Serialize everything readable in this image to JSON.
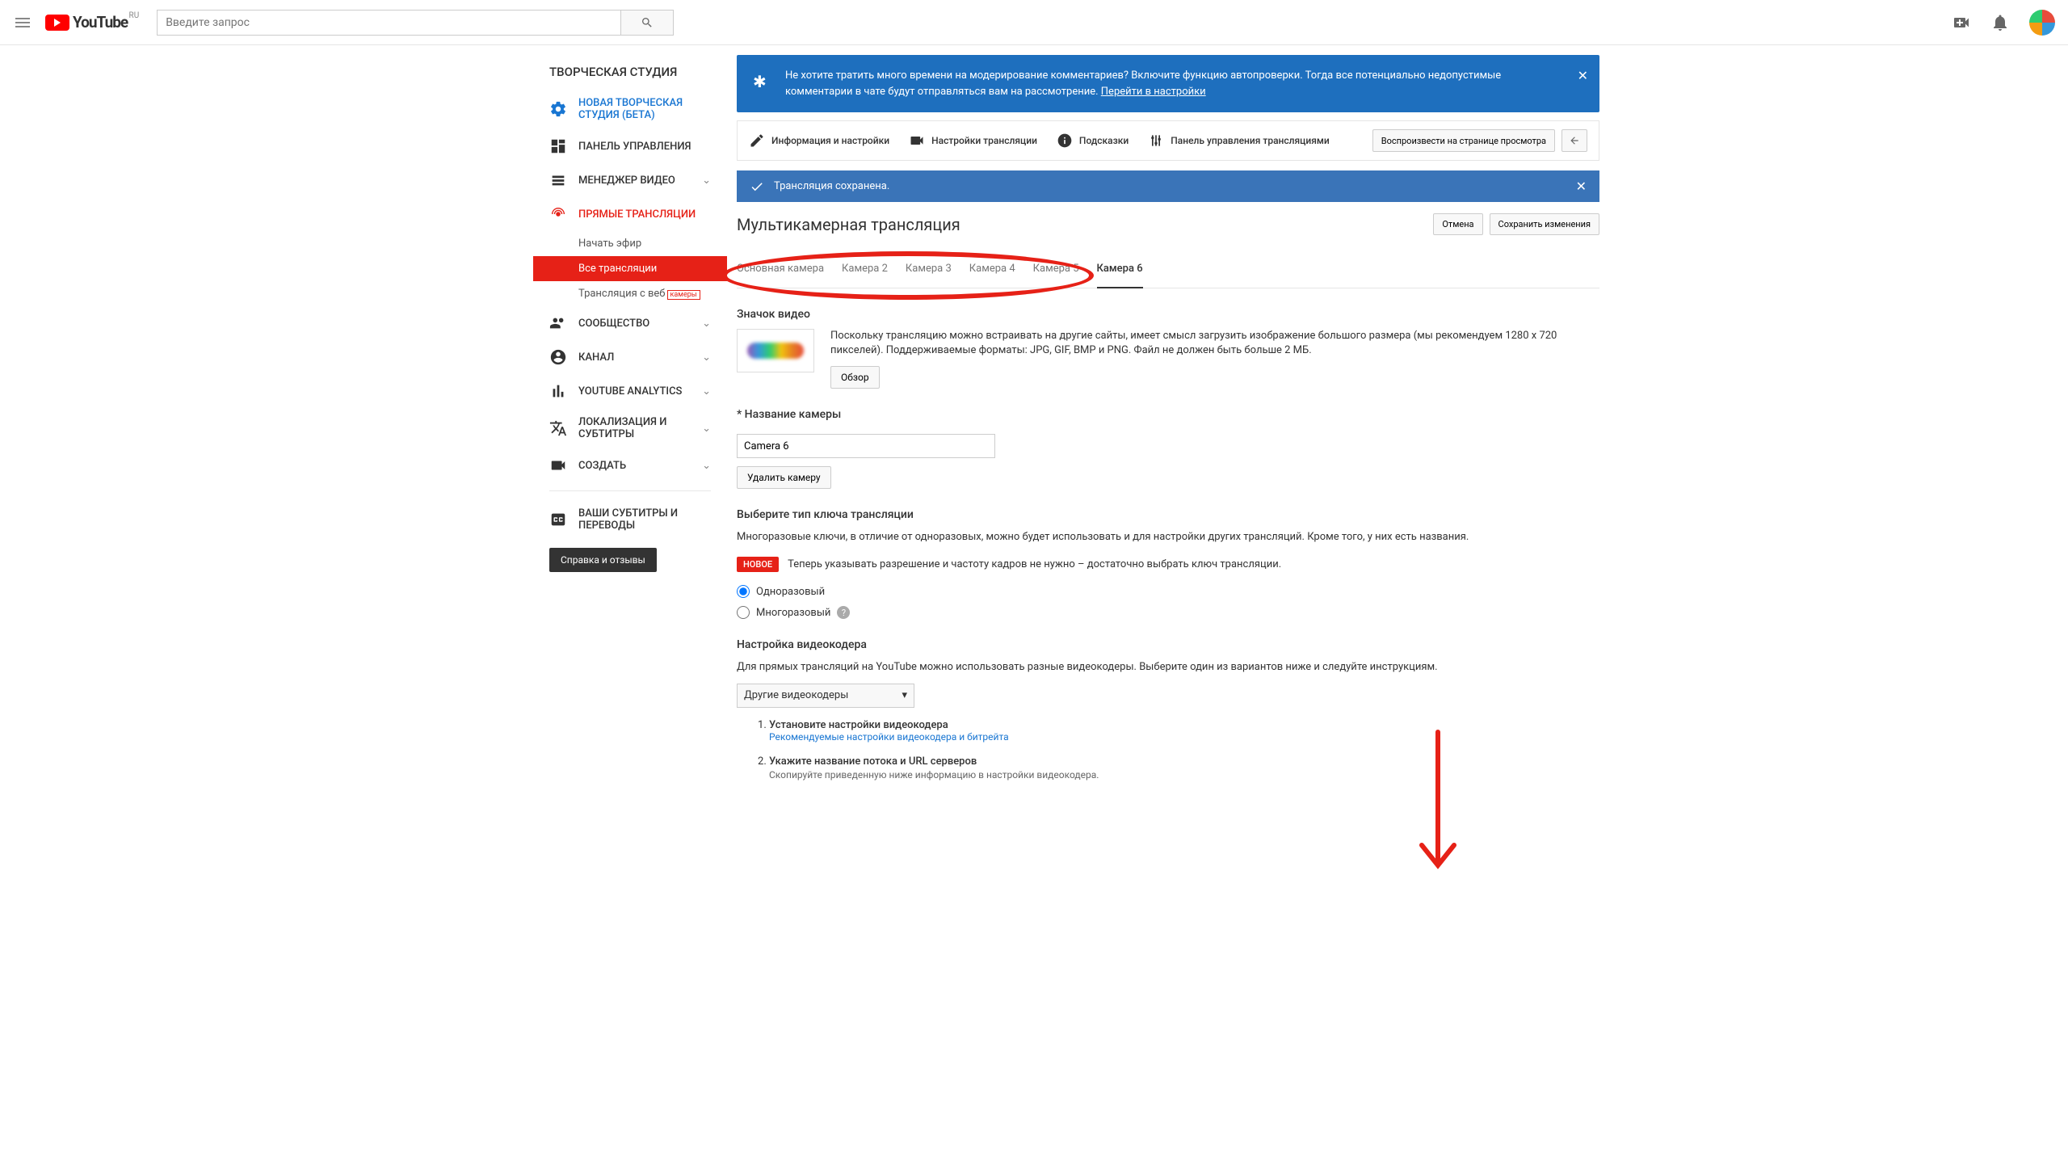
{
  "header": {
    "logo_text": "YouTube",
    "logo_region": "RU",
    "search_placeholder": "Введите запрос"
  },
  "sidebar": {
    "title": "ТВОРЧЕСКАЯ СТУДИЯ",
    "new_studio": "НОВАЯ ТВОРЧЕСКАЯ СТУДИЯ (БЕТА)",
    "dashboard": "ПАНЕЛЬ УПРАВЛЕНИЯ",
    "video_manager": "МЕНЕДЖЕР ВИДЕО",
    "live": "ПРЯМЫЕ ТРАНСЛЯЦИИ",
    "live_sub": {
      "start": "Начать эфир",
      "all": "Все трансляции",
      "webcam": "Трансляция с веб",
      "webcam_badge": "камеры"
    },
    "community": "СООБЩЕСТВО",
    "channel": "КАНАЛ",
    "analytics": "YOUTUBE ANALYTICS",
    "localization": "ЛОКАЛИЗАЦИЯ И СУБТИТРЫ",
    "create": "СОЗДАТЬ",
    "captions": "ВАШИ СУБТИТРЫ И ПЕРЕВОДЫ",
    "feedback": "Справка и отзывы"
  },
  "banner": {
    "text": "Не хотите тратить много времени на модерирование комментариев? Включите функцию автопроверки. Тогда все потенциально недопустимые комментарии в чате будут отправляться вам на рассмотрение. ",
    "link": "Перейти в настройки"
  },
  "toolbar": {
    "info": "Информация и настройки",
    "stream_settings": "Настройки трансляции",
    "cards": "Подсказки",
    "control_panel": "Панель управления трансляциями",
    "play": "Воспроизвести на странице просмотра"
  },
  "status": "Трансляция сохранена.",
  "page_title": "Мультикамерная трансляция",
  "actions": {
    "cancel": "Отмена",
    "save": "Сохранить изменения"
  },
  "tabs": [
    "Основная камера",
    "Камера 2",
    "Камера 3",
    "Камера 4",
    "Камера 5",
    "Камера 6"
  ],
  "active_tab": 5,
  "thumbnail": {
    "title": "Значок видео",
    "text": "Поскольку трансляцию можно встраивать на другие сайты, имеет смысл загрузить изображение большого размера (мы рекомендуем 1280 x 720 пикселей). Поддерживаемые форматы: JPG, GIF, BMP и PNG. Файл не должен быть больше 2 МБ.",
    "browse": "Обзор"
  },
  "camera_name": {
    "label": "* Название камеры",
    "value": "Camera 6",
    "delete": "Удалить камеру"
  },
  "key_type": {
    "title": "Выберите тип ключа трансляции",
    "text": "Многоразовые ключи, в отличие от одноразовых, можно будет использовать и для настройки других трансляций. Кроме того, у них есть названия.",
    "new_badge": "НОВОЕ",
    "new_text": "Теперь указывать разрешение и частоту кадров не нужно – достаточно выбрать ключ трансляции.",
    "single": "Одноразовый",
    "multi": "Многоразовый"
  },
  "encoder": {
    "title": "Настройка видеокодера",
    "text": "Для прямых трансляций на YouTube можно использовать разные видеокодеры. Выберите один из вариантов ниже и следуйте инструкциям.",
    "select": "Другие видеокодеры",
    "steps": [
      {
        "title": "Установите настройки видеокодера",
        "sub": "Рекомендуемые настройки видеокодера и битрейта"
      },
      {
        "title": "Укажите название потока и URL серверов",
        "sub": "Скопируйте приведенную ниже информацию в настройки видеокодера."
      }
    ]
  }
}
